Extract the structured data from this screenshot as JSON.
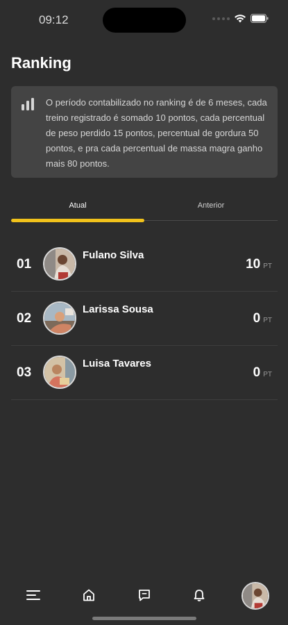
{
  "status": {
    "time": "09:12"
  },
  "title": "Ranking",
  "info": {
    "icon": "bar-chart-icon",
    "text": "O período contabilizado no ranking é de 6 meses, cada treino registrado é somado 10 pontos, cada percentual de peso perdido 15 pontos, percentual de gordura 50 pontos, e pra cada percentual de massa magra ganho mais 80 pontos."
  },
  "tabs": [
    {
      "label": "Atual",
      "active": true
    },
    {
      "label": "Anterior",
      "active": false
    }
  ],
  "ranking": [
    {
      "position": "01",
      "name": "Fulano Silva",
      "points": "10",
      "unit": "PT"
    },
    {
      "position": "02",
      "name": "Larissa Sousa",
      "points": "0",
      "unit": "PT"
    },
    {
      "position": "03",
      "name": "Luisa Tavares",
      "points": "0",
      "unit": "PT"
    }
  ],
  "nav": {
    "items": [
      "menu-icon",
      "home-icon",
      "chat-icon",
      "bell-icon"
    ],
    "profile": "profile-avatar"
  },
  "colors": {
    "background": "#2d2d2d",
    "accent": "#f1c21b",
    "card": "#444444"
  }
}
